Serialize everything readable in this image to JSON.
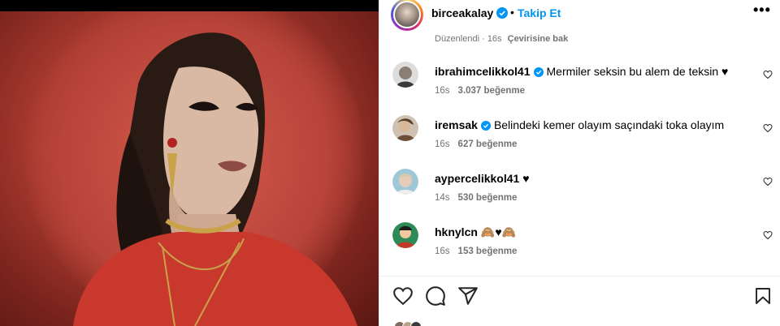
{
  "post": {
    "author": "birceakalay",
    "separator": "•",
    "follow_label": "Takip Et",
    "more_label": "•••",
    "edited_label": "Düzenlendi · 16s",
    "translate_label": "Çevirisine bak"
  },
  "comments": [
    {
      "user": "ibrahimcelikkol41",
      "verified": true,
      "text": "Mermiler seksin bu alem de teksin ♥",
      "time": "16s",
      "likes": "3.037 beğenme"
    },
    {
      "user": "iremsak",
      "verified": true,
      "text": "Belindeki kemer olayım saçındaki toka olayım",
      "time": "16s",
      "likes": "627 beğenme"
    },
    {
      "user": "aypercelikkol41",
      "verified": false,
      "text": "♥",
      "time": "14s",
      "likes": "530 beğenme"
    },
    {
      "user": "hknylcn",
      "verified": false,
      "text": "🙈♥🙈",
      "time": "16s",
      "likes": "153 beğenme"
    }
  ],
  "icons": {
    "verified": "verified-badge-icon",
    "like": "heart-icon",
    "comment": "comment-bubble-icon",
    "share": "paper-plane-icon",
    "save": "bookmark-icon"
  },
  "colors": {
    "accent": "#0095f6",
    "verified": "#0095f6",
    "meta_text": "#737373",
    "photo_background": "#b8443a"
  }
}
